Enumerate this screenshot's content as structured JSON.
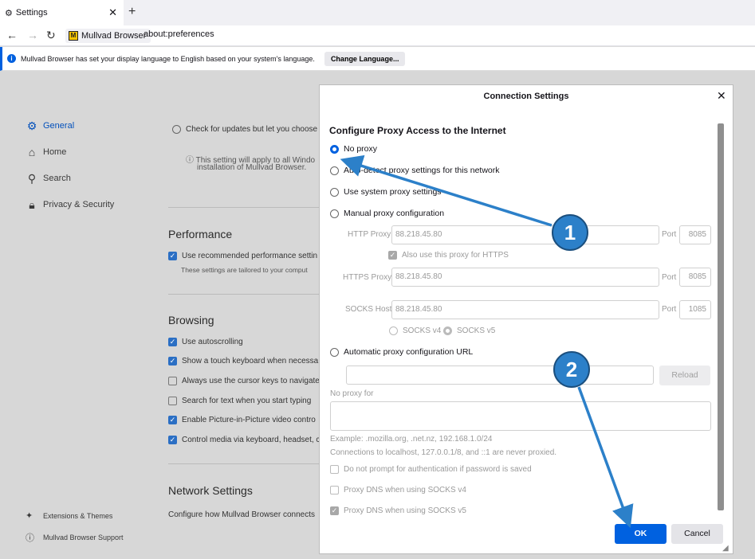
{
  "browser": {
    "tab_title": "Settings",
    "identity_label": "Mullvad Browser",
    "logo_letter": "M",
    "url": "about:preferences"
  },
  "notification": {
    "text": "Mullvad Browser has set your display language to English based on your system's language.",
    "button": "Change Language..."
  },
  "sidebar": {
    "items": [
      {
        "label": "General",
        "icon": "gear-icon"
      },
      {
        "label": "Home",
        "icon": "home-icon"
      },
      {
        "label": "Search",
        "icon": "search-icon"
      },
      {
        "label": "Privacy & Security",
        "icon": "lock-icon"
      }
    ],
    "footer": [
      {
        "label": "Extensions & Themes",
        "icon": "puzzle-icon"
      },
      {
        "label": "Mullvad Browser Support",
        "icon": "help-icon"
      }
    ]
  },
  "page": {
    "update_option": "Check for updates but let you choose",
    "update_note_1": "This setting will apply to all Windo",
    "update_note_2": "installation of Mullvad Browser.",
    "performance": {
      "heading": "Performance",
      "option": "Use recommended performance settin",
      "note": "These settings are tailored to your comput"
    },
    "browsing": {
      "heading": "Browsing",
      "options": [
        {
          "label": "Use autoscrolling",
          "checked": true
        },
        {
          "label": "Show a touch keyboard when necessa",
          "checked": true
        },
        {
          "label": "Always use the cursor keys to navigate",
          "checked": false
        },
        {
          "label": "Search for text when you start typing",
          "checked": false
        },
        {
          "label": "Enable Picture-in-Picture video contro",
          "checked": true
        },
        {
          "label": "Control media via keyboard, headset, c",
          "checked": true
        }
      ]
    },
    "network": {
      "heading": "Network Settings",
      "text": "Configure how Mullvad Browser connects"
    }
  },
  "dialog": {
    "title": "Connection Settings",
    "heading": "Configure Proxy Access to the Internet",
    "radios": {
      "no_proxy": "No proxy",
      "auto_detect": "Auto-detect proxy settings for this network",
      "system": "Use system proxy settings",
      "manual": "Manual proxy configuration",
      "auto_url": "Automatic proxy configuration URL"
    },
    "selected": "no_proxy",
    "http": {
      "label": "HTTP Proxy",
      "value": "88.218.45.80",
      "port_label": "Port",
      "port": "8085"
    },
    "also_https": "Also use this proxy for HTTPS",
    "https": {
      "label": "HTTPS Proxy",
      "value": "88.218.45.80",
      "port_label": "Port",
      "port": "8085"
    },
    "socks": {
      "label": "SOCKS Host",
      "value": "88.218.45.80",
      "port_label": "Port",
      "port": "1085"
    },
    "socks_v4": "SOCKS v4",
    "socks_v5": "SOCKS v5",
    "reload": "Reload",
    "no_proxy_for": "No proxy for",
    "example": "Example: .mozilla.org, .net.nz, 192.168.1.0/24",
    "localhost_note": "Connections to localhost, 127.0.0.1/8, and ::1 are never proxied.",
    "no_prompt_auth": "Do not prompt for authentication if password is saved",
    "dns_v4": "Proxy DNS when using SOCKS v4",
    "dns_v5": "Proxy DNS when using SOCKS v5",
    "ok": "OK",
    "cancel": "Cancel"
  },
  "annotations": {
    "badge1": "1",
    "badge2": "2",
    "arrow_color": "#2c80c9"
  }
}
